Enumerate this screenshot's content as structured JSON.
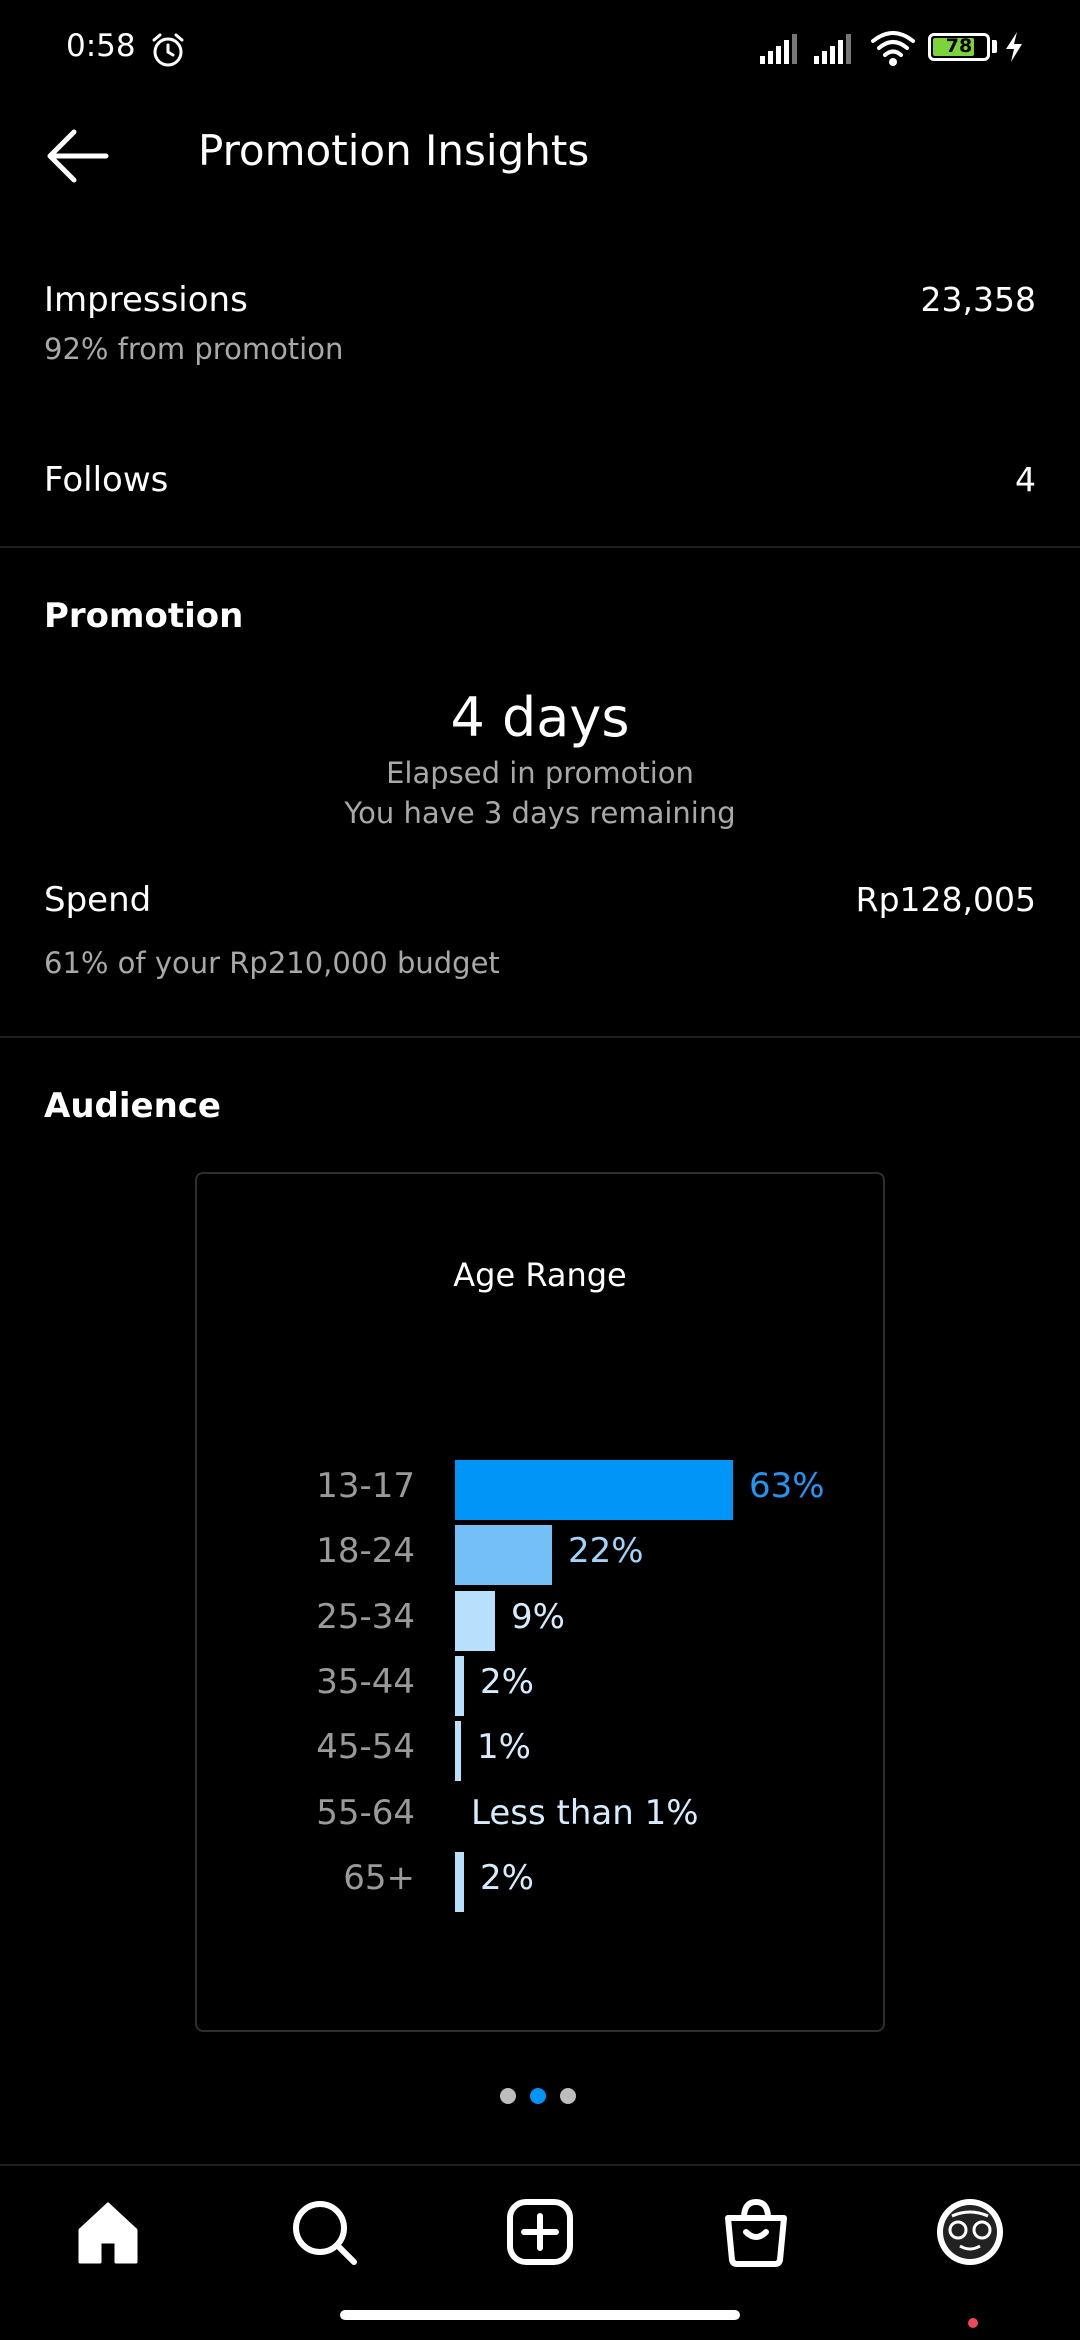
{
  "status_bar": {
    "time": "0:58",
    "battery_level": "78",
    "battery_color": "#7dd33a"
  },
  "header": {
    "title": "Promotion Insights",
    "back_icon": "arrow-left-icon"
  },
  "metrics": {
    "impressions_label": "Impressions",
    "impressions_value": "23,358",
    "impressions_sub": "92% from promotion",
    "follows_label": "Follows",
    "follows_value": "4"
  },
  "promotion": {
    "section_title": "Promotion",
    "days_value": "4 days",
    "elapsed_text": "Elapsed in promotion",
    "remaining_text": "You have 3 days remaining",
    "spend_label": "Spend",
    "spend_value": "Rp128,005",
    "budget_text": "61% of your Rp210,000 budget"
  },
  "audience": {
    "section_title": "Audience"
  },
  "chart_data": {
    "type": "bar",
    "orientation": "horizontal",
    "title": "Age Range",
    "categories": [
      "13-17",
      "18-24",
      "25-34",
      "35-44",
      "45-54",
      "55-64",
      "65+"
    ],
    "values": [
      63,
      22,
      9,
      2,
      1,
      0.5,
      2
    ],
    "value_labels": [
      "63%",
      "22%",
      "9%",
      "2%",
      "1%",
      "Less than 1%",
      "2%"
    ],
    "bar_colors": [
      "#0095f6",
      "#74bff8",
      "#b7e0fc",
      "#b7e0fc",
      "#b7e0fc",
      "#b7e0fc",
      "#b7e0fc"
    ],
    "label_colors": [
      "#2196f3",
      "#9fd3fa",
      "#d6ecfd",
      "#d6ecfd",
      "#d6ecfd",
      "#d6ecfd",
      "#d6ecfd"
    ],
    "xlim": [
      0,
      63
    ]
  },
  "pager": {
    "page_count": 3,
    "active_index": 1,
    "active_color": "#0095f6"
  },
  "bottom_nav": {
    "items": [
      "home-icon",
      "search-icon",
      "create-post-icon",
      "shop-icon",
      "profile-avatar-icon"
    ]
  }
}
